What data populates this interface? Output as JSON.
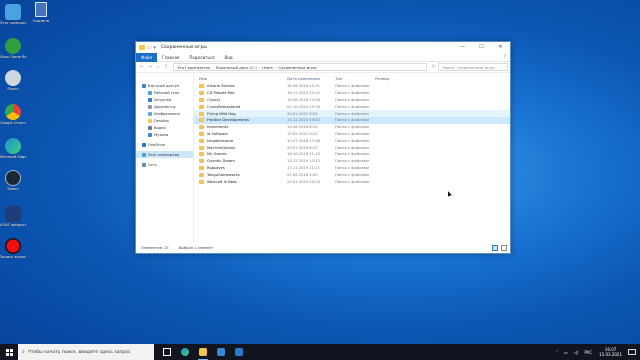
{
  "desktop": {
    "recycle_bin_label": "Корзина",
    "icons": [
      {
        "label": "Этот компьютер",
        "color": "#4aa3df"
      },
      {
        "label": "Xbox Game Bar",
        "color": "#2e9e3f"
      },
      {
        "label": "Steam",
        "color": "#cfd6dd"
      },
      {
        "label": "Google Chrome",
        "color": "#e94235"
      },
      {
        "label": "Microsoft Edge",
        "color": "#1c8fd8"
      },
      {
        "label": "Steam",
        "color": "#1b2838"
      },
      {
        "label": "ASUS продукты",
        "color": "#1e3d7a"
      },
      {
        "label": "Запись экрана",
        "color": "#d11"
      }
    ]
  },
  "window": {
    "title": "Сохраненные игры",
    "controls": {
      "minimize": "—",
      "maximize": "☐",
      "close": "✕"
    },
    "ribbon_tabs": {
      "file": "Файл",
      "home": "Главная",
      "share": "Поделиться",
      "view": "Вид",
      "help": "?"
    },
    "address": {
      "crumbs": [
        "Этот компьютер",
        "Локальный диск (C:)",
        "Users",
        "Сохраненные игры"
      ],
      "search_placeholder": "Поиск: Сохраненные игры"
    },
    "nav_pane": {
      "quick_access": "Быстрый доступ",
      "desktop": "Рабочий стол",
      "downloads": "Загрузки",
      "documents": "Документы",
      "pictures": "Изображения",
      "desktop_folder": "Desktop",
      "video": "Видео",
      "music": "Музыка",
      "onedrive": "OneDrive",
      "this_pc": "Этот компьютер",
      "network": "Сеть"
    },
    "columns": {
      "name": "Имя",
      "date": "Дата изменения",
      "type": "Тип",
      "size": "Размер"
    },
    "files": [
      {
        "name": "Arkane Studios",
        "date": "18.08.2016 20:11",
        "type": "Папка с файлами"
      },
      {
        "name": "CD Projekt Red",
        "date": "18.12.2020 22:15",
        "type": "Папка с файлами"
      },
      {
        "name": "Crysis2",
        "date": "19.08.2016 12:06",
        "type": "Папка с файлами"
      },
      {
        "name": "CrysisRemastered",
        "date": "01.10.2020 19:38",
        "type": "Папка с файлами"
      },
      {
        "name": "Flying Wild Hog",
        "date": "20.01.2021 9:04",
        "type": "Папка с файлами"
      },
      {
        "name": "Frontier Developments",
        "date": "14.12.2020 20:02",
        "type": "Папка с файлами"
      },
      {
        "name": "homefront2",
        "date": "10.06.2016 8:10",
        "type": "Папка с файлами"
      },
      {
        "name": "id Software",
        "date": "10.02.2021 0:22",
        "type": "Папка с файлами"
      },
      {
        "name": "kingdomcome",
        "date": "30.07.2018 17:46",
        "type": "Папка с файлами"
      },
      {
        "name": "MachineGames",
        "date": "25.07.2019 8:23",
        "type": "Папка с файлами"
      },
      {
        "name": "My Games",
        "date": "16.10.2016 21:10",
        "type": "Папка с файлами"
      },
      {
        "name": "Quantic Dream",
        "date": "13.12.2019 13:13",
        "type": "Папка с файлами"
      },
      {
        "name": "Rpgsaves",
        "date": "17.11.2019 11:11",
        "type": "Папка с файлами"
      },
      {
        "name": "TangoGameworks",
        "date": "27.05.2018 4:40",
        "type": "Папка с файлами"
      },
      {
        "name": "Warcraft III Beta",
        "date": "22.01.2020 20:34",
        "type": "Папка с файлами"
      }
    ],
    "status": {
      "count": "Элементов: 15",
      "selected": "Выбран 1 элемент"
    }
  },
  "taskbar": {
    "search_placeholder": "Чтобы начать поиск, введите здесь запрос",
    "lang": "РУС",
    "time": "16:07",
    "date": "15.03.2021"
  }
}
